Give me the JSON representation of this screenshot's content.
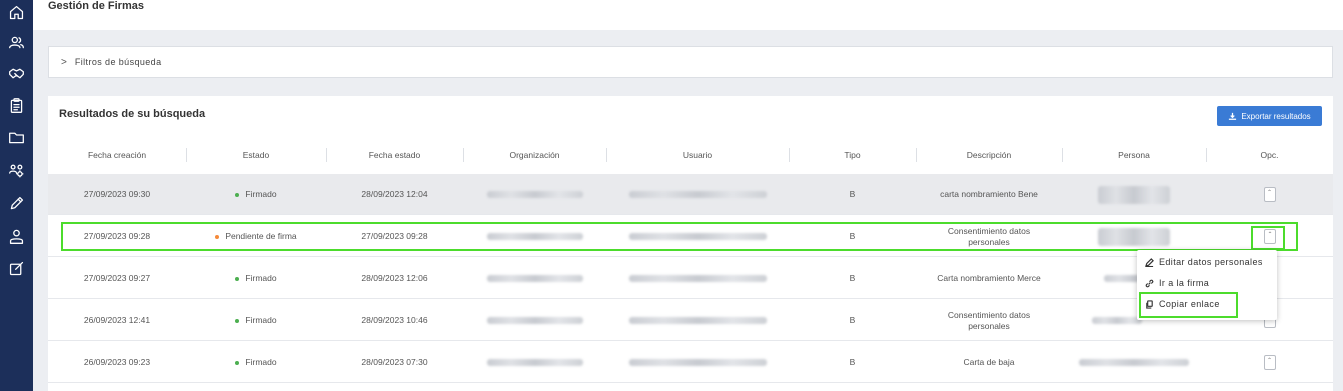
{
  "page_title": "Gestión de Firmas",
  "filters": {
    "toggle_icon": "chevron-right-icon",
    "label": "Filtros de búsqueda"
  },
  "results": {
    "title": "Resultados de su búsqueda",
    "export_label": "Exportar resultados",
    "export_icon": "download-icon",
    "columns": [
      "Fecha creación",
      "Estado",
      "Fecha estado",
      "Organización",
      "Usuario",
      "Tipo",
      "Descripción",
      "Persona",
      "Opc."
    ],
    "rows": [
      {
        "fecha_creacion": "27/09/2023 09:30",
        "estado": "Firmado",
        "estado_color": "#4caf50",
        "fecha_estado": "28/09/2023 12:04",
        "tipo": "B",
        "descripcion": "carta nombramiento Bene"
      },
      {
        "fecha_creacion": "27/09/2023 09:28",
        "estado": "Pendiente de firma",
        "estado_color": "#f58a3a",
        "fecha_estado": "27/09/2023 09:28",
        "tipo": "B",
        "descripcion": "Consentimiento datos personales"
      },
      {
        "fecha_creacion": "27/09/2023 09:27",
        "estado": "Firmado",
        "estado_color": "#4caf50",
        "fecha_estado": "28/09/2023 12:06",
        "tipo": "B",
        "descripcion": "Carta nombramiento Merce"
      },
      {
        "fecha_creacion": "26/09/2023 12:41",
        "estado": "Firmado",
        "estado_color": "#4caf50",
        "fecha_estado": "28/09/2023 10:46",
        "tipo": "B",
        "descripcion": "Consentimiento datos personales"
      },
      {
        "fecha_creacion": "26/09/2023 09:23",
        "estado": "Firmado",
        "estado_color": "#4caf50",
        "fecha_estado": "28/09/2023 07:30",
        "tipo": "B",
        "descripcion": "Carta de baja"
      }
    ]
  },
  "context_menu": {
    "items": [
      {
        "label": "Editar datos personales",
        "icon": "pencil-icon"
      },
      {
        "label": "Ir a la firma",
        "icon": "link-icon"
      },
      {
        "label": "Copiar enlace",
        "icon": "copy-icon"
      }
    ]
  },
  "sidebar_icons": [
    "home-icon",
    "users-icon",
    "handshake-icon",
    "clipboard-icon",
    "folder-icon",
    "team-settings-icon",
    "pen-icon",
    "person-icon",
    "edit-square-icon"
  ],
  "colors": {
    "sidebar": "#1c2f5a",
    "accent": "#3a7bd5",
    "highlight": "#4cdc2c"
  }
}
